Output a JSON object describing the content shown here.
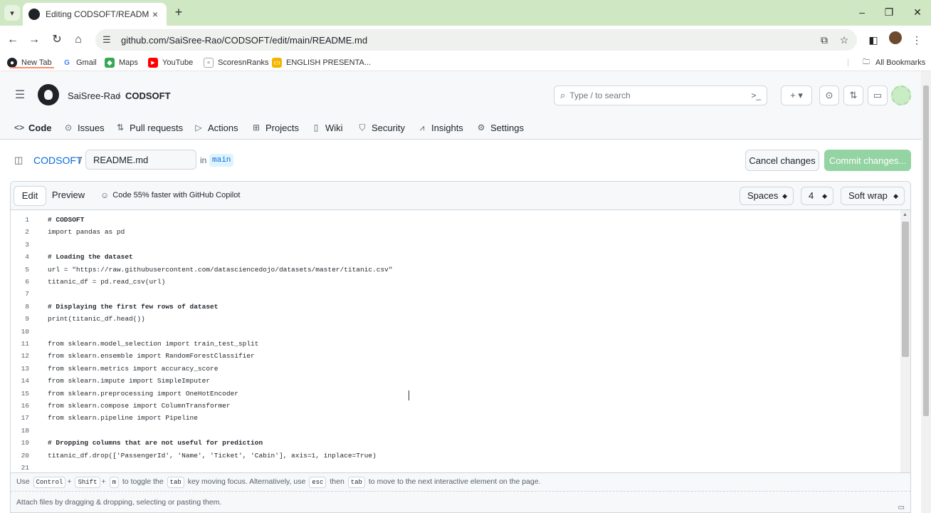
{
  "browser": {
    "tab_title": "Editing CODSOFT/README.md",
    "url": "github.com/SaiSree-Rao/CODSOFT/edit/main/README.md",
    "bookmarks": [
      {
        "label": "New Tab"
      },
      {
        "label": "Gmail"
      },
      {
        "label": "Maps"
      },
      {
        "label": "YouTube"
      },
      {
        "label": "ScoresnRanks"
      },
      {
        "label": "ENGLISH PRESENTA..."
      }
    ],
    "all_bookmarks": "All Bookmarks"
  },
  "header": {
    "owner": "SaiSree-Rao",
    "separator": "/",
    "repo": "CODSOFT",
    "search_placeholder": "Type / to search"
  },
  "repo_nav": [
    {
      "label": "Code",
      "icon": "code-icon"
    },
    {
      "label": "Issues",
      "icon": "issue-icon"
    },
    {
      "label": "Pull requests",
      "icon": "pull-request-icon"
    },
    {
      "label": "Actions",
      "icon": "play-icon"
    },
    {
      "label": "Projects",
      "icon": "table-icon"
    },
    {
      "label": "Wiki",
      "icon": "book-icon"
    },
    {
      "label": "Security",
      "icon": "shield-icon"
    },
    {
      "label": "Insights",
      "icon": "graph-icon"
    },
    {
      "label": "Settings",
      "icon": "gear-icon"
    }
  ],
  "pathbar": {
    "repo_link": "CODSOFT",
    "slash": "/",
    "filename": "README.md",
    "in_label": "in",
    "branch": "main",
    "cancel_label": "Cancel changes",
    "commit_label": "Commit changes..."
  },
  "editor": {
    "tab_edit": "Edit",
    "tab_preview": "Preview",
    "copilot": "Code 55% faster with GitHub Copilot",
    "indent_mode": "Spaces",
    "indent_size": "4",
    "wrap_mode": "Soft wrap",
    "lines": [
      {
        "n": "1",
        "text": "# CODSOFT",
        "comment": true
      },
      {
        "n": "2",
        "text": "import pandas as pd",
        "comment": false
      },
      {
        "n": "3",
        "text": "",
        "comment": false
      },
      {
        "n": "4",
        "text": "# Loading the dataset",
        "comment": true
      },
      {
        "n": "5",
        "text": "url = \"https://raw.githubusercontent.com/datasciencedojo/datasets/master/titanic.csv\"",
        "comment": false
      },
      {
        "n": "6",
        "text": "titanic_df = pd.read_csv(url)",
        "comment": false
      },
      {
        "n": "7",
        "text": "",
        "comment": false
      },
      {
        "n": "8",
        "text": "# Displaying the first few rows of dataset",
        "comment": true
      },
      {
        "n": "9",
        "text": "print(titanic_df.head())",
        "comment": false
      },
      {
        "n": "10",
        "text": "",
        "comment": false
      },
      {
        "n": "11",
        "text": "from sklearn.model_selection import train_test_split",
        "comment": false
      },
      {
        "n": "12",
        "text": "from sklearn.ensemble import RandomForestClassifier",
        "comment": false
      },
      {
        "n": "13",
        "text": "from sklearn.metrics import accuracy_score",
        "comment": false
      },
      {
        "n": "14",
        "text": "from sklearn.impute import SimpleImputer",
        "comment": false
      },
      {
        "n": "15",
        "text": "from sklearn.preprocessing import OneHotEncoder",
        "comment": false
      },
      {
        "n": "16",
        "text": "from sklearn.compose import ColumnTransformer",
        "comment": false
      },
      {
        "n": "17",
        "text": "from sklearn.pipeline import Pipeline",
        "comment": false
      },
      {
        "n": "18",
        "text": "",
        "comment": false
      },
      {
        "n": "19",
        "text": "# Dropping columns that are not useful for prediction",
        "comment": true
      },
      {
        "n": "20",
        "text": "titanic_df.drop(['PassengerId', 'Name', 'Ticket', 'Cabin'], axis=1, inplace=True)",
        "comment": false
      },
      {
        "n": "21",
        "text": "",
        "comment": false
      }
    ],
    "hint": {
      "use": "Use",
      "k1": "Control",
      "plus1": "+",
      "k2": "Shift",
      "plus2": "+",
      "k3": "m",
      "t1": "to toggle the",
      "k4": "tab",
      "t2": "key moving focus. Alternatively, use",
      "k5": "esc",
      "t3": "then",
      "k6": "tab",
      "t4": "to move to the next interactive element on the page."
    },
    "attach": "Attach files by dragging & dropping, selecting or pasting them."
  }
}
